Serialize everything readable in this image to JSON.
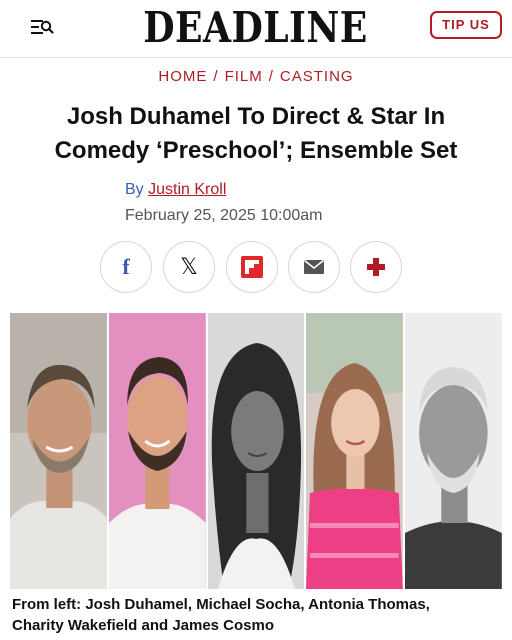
{
  "header": {
    "logo_text": "DEADLINE",
    "menu_icon": "menu-search-icon",
    "tip_label": "TIP US",
    "accent_color": "#b01c22"
  },
  "breadcrumb": {
    "items": [
      "HOME",
      "FILM",
      "CASTING"
    ],
    "separator": "/"
  },
  "article": {
    "headline_line1": "Josh Duhamel To Direct & Star In",
    "headline_line2": "Comedy ‘Preschool’; Ensemble Set",
    "by_prefix": "By",
    "author": "Justin Kroll",
    "date": "February 25, 2025 10:00am"
  },
  "share": {
    "buttons": [
      {
        "icon": "facebook-icon",
        "glyph": "f"
      },
      {
        "icon": "x-icon",
        "glyph": "𝕏"
      },
      {
        "icon": "flipboard-icon"
      },
      {
        "icon": "email-icon"
      },
      {
        "icon": "more-share-icon"
      }
    ]
  },
  "photo": {
    "panels": [
      "josh-duhamel",
      "michael-socha",
      "antonia-thomas",
      "charity-wakefield",
      "james-cosmo"
    ],
    "caption_line1": "From left: Josh Duhamel, Michael Socha, Antonia Thomas,",
    "caption_line2": "Charity Wakefield and James Cosmo"
  }
}
